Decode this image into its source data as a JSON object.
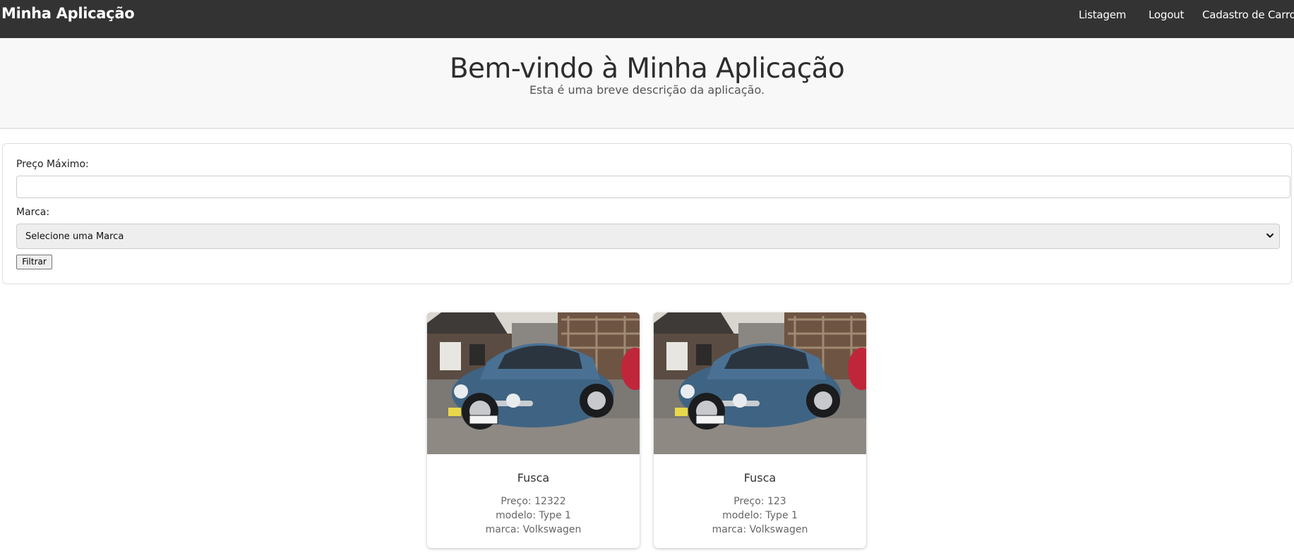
{
  "navbar": {
    "brand": "Minha Aplicação",
    "links": [
      "Listagem",
      "Logout",
      "Cadastro de Carro"
    ],
    "background": "#333333"
  },
  "hero": {
    "title": "Bem-vindo à Minha Aplicação",
    "subtitle": "Esta é uma breve descrição da aplicação."
  },
  "filter": {
    "price_label": "Preço Máximo:",
    "price_value": "",
    "brand_label": "Marca:",
    "brand_selected": "Selecione uma Marca",
    "submit_label": "Filtrar"
  },
  "cars": [
    {
      "title": "Fusca",
      "price": "Preço: 12322",
      "model": "modelo: Type 1",
      "brand": "marca: Volkswagen",
      "image": "blue-volkswagen-beetle-photo"
    },
    {
      "title": "Fusca",
      "price": "Preço: 123",
      "model": "modelo: Type 1",
      "brand": "marca: Volkswagen",
      "image": "blue-volkswagen-beetle-photo"
    }
  ],
  "icons": {
    "select_arrow": "chevron-down-icon"
  }
}
